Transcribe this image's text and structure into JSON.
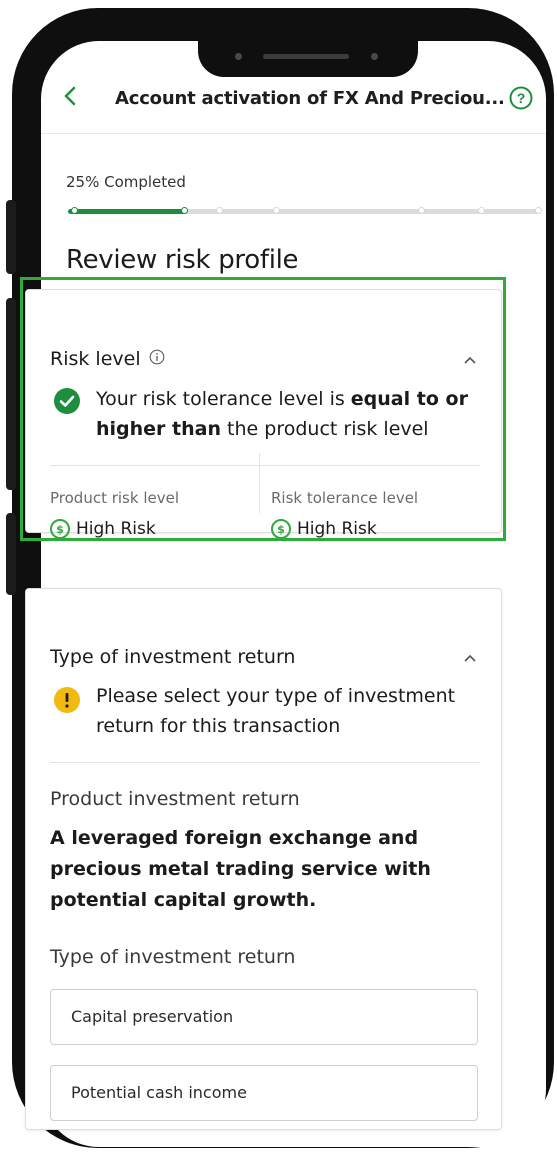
{
  "header": {
    "title": "Account activation of FX And Preciou...",
    "back_icon": "chevron-left-icon",
    "help_icon": "question-circle-icon"
  },
  "progress": {
    "label": "25% Completed",
    "value": 0.25,
    "steps": 8,
    "completed_steps": 2
  },
  "page_title": "Review risk profile",
  "risk_card": {
    "heading": "Risk level",
    "info_icon": "info-icon",
    "collapse_icon": "chevron-up-icon",
    "status_icon": "check-circle-icon",
    "status_text_1": "Your risk tolerance level is ",
    "status_text_bold": "equal to or higher than",
    "status_text_2": " the product risk level",
    "product_label": "Product risk level",
    "product_value": "High Risk",
    "tolerance_label": "Risk tolerance level",
    "tolerance_value": "High Risk",
    "risk_icon_symbol": "$"
  },
  "return_card": {
    "heading": "Type of investment return",
    "collapse_icon": "chevron-up-icon",
    "warning_icon": "exclamation-circle-icon",
    "warning_text": "Please select your type of investment return for this transaction",
    "product_return_label": "Product investment return",
    "product_return_desc": "A leveraged foreign exchange and precious metal trading service with potential capital growth.",
    "type_label": "Type of investment return",
    "options": [
      "Capital preservation",
      "Potential cash income"
    ]
  },
  "colors": {
    "accent_green": "#1e8e3e",
    "highlight_green": "#2eab3b",
    "warning_yellow": "#f2b90f"
  }
}
